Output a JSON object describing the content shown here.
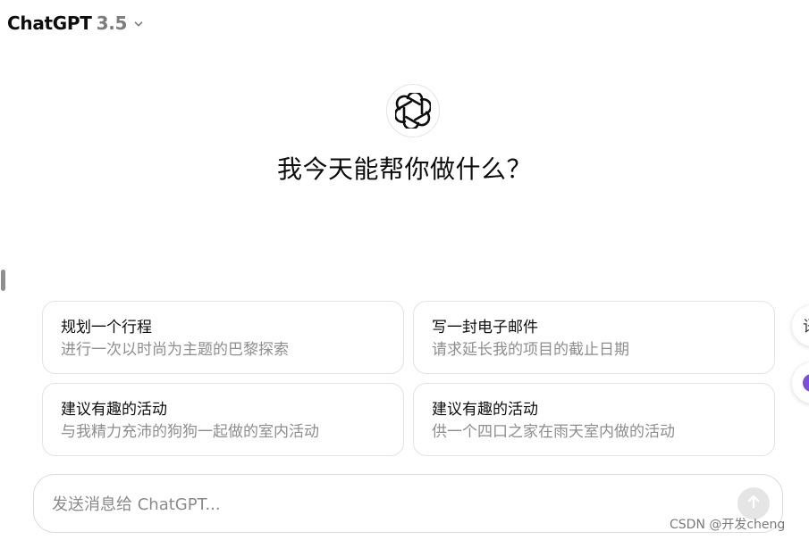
{
  "header": {
    "model_name": "ChatGPT",
    "model_version": "3.5"
  },
  "main": {
    "greeting": "我今天能帮你做什么？"
  },
  "suggestions": [
    {
      "title": "规划一个行程",
      "subtitle": "进行一次以时尚为主题的巴黎探索"
    },
    {
      "title": "写一封电子邮件",
      "subtitle": "请求延长我的项目的截止日期"
    },
    {
      "title": "建议有趣的活动",
      "subtitle": "与我精力充沛的狗狗一起做的室内活动"
    },
    {
      "title": "建议有趣的活动",
      "subtitle": "供一个四口之家在雨天室内做的活动"
    }
  ],
  "side_panel": {
    "top_button_glyph": "语"
  },
  "composer": {
    "placeholder": "发送消息给 ChatGPT..."
  },
  "watermark": "CSDN @开发cheng",
  "colors": {
    "text_primary": "#0d0d0d",
    "text_secondary": "#8e8e8e",
    "border": "#e3e3e3",
    "send_button_bg": "#e5e5e5",
    "accent_purple": "#7c4dde"
  },
  "icons": {
    "logo": "openai-logo-icon",
    "model_dropdown": "chevron-down-icon",
    "send": "arrow-up-icon"
  }
}
